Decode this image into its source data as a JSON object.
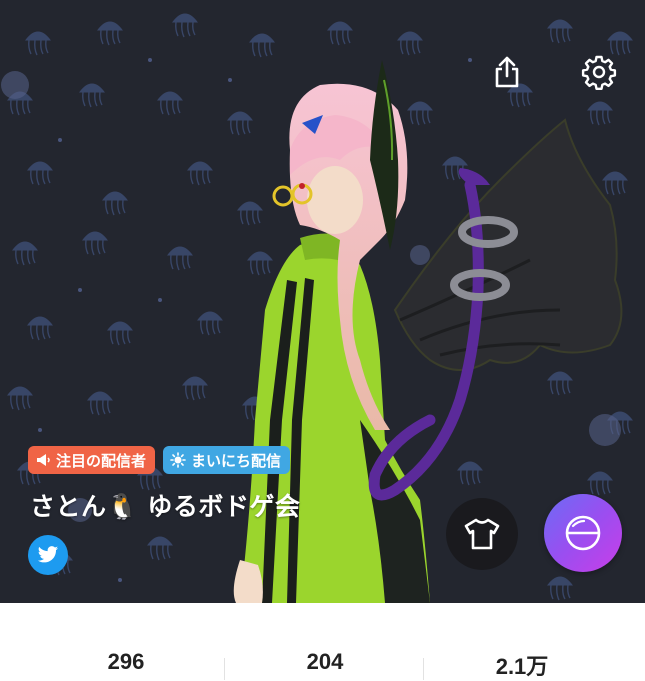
{
  "profile": {
    "name": "さとん🐧 ゆるボドゲ会",
    "badges": [
      {
        "label": "注目の配信者",
        "icon": "megaphone-icon",
        "color": "#f06446"
      },
      {
        "label": "まいにち配信",
        "icon": "sun-icon",
        "color": "#40a7e3"
      }
    ]
  },
  "header": {
    "share_icon": "share-icon",
    "settings_icon": "gear-icon"
  },
  "social": {
    "twitter_icon": "twitter-icon"
  },
  "actions": {
    "outfit_icon": "shirt-icon",
    "orb_icon": "orb-icon"
  },
  "stats": [
    {
      "value": "296"
    },
    {
      "value": "204"
    },
    {
      "value": "2.1万"
    }
  ],
  "colors": {
    "hero_bg": "#23262f",
    "accent_purple": "#9a4ef0",
    "twitter_blue": "#1d9bf0"
  }
}
